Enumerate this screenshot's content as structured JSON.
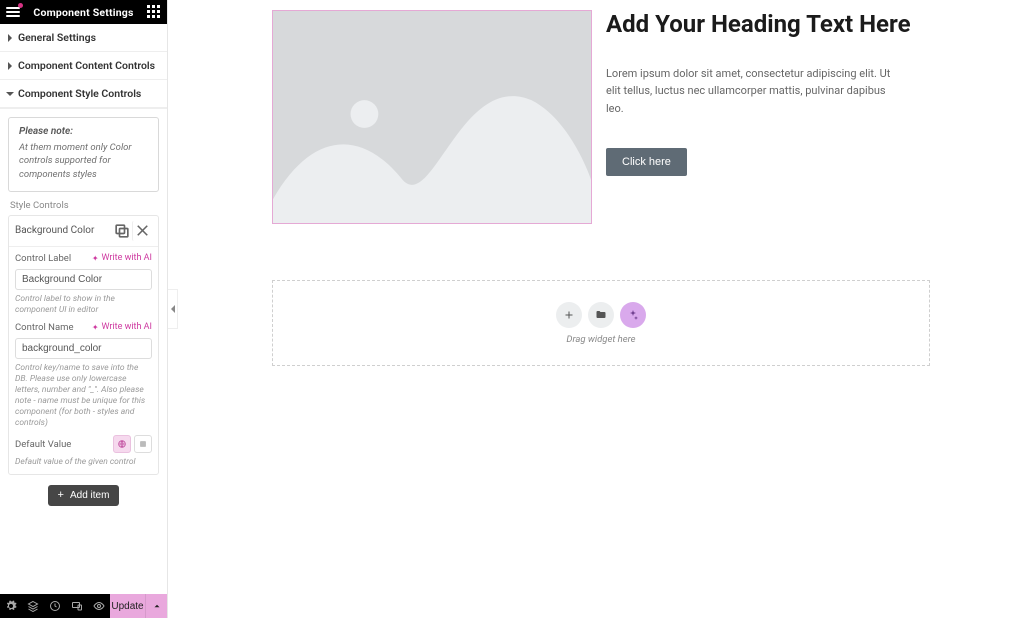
{
  "header": {
    "title": "Component Settings"
  },
  "accordion": {
    "general": "General Settings",
    "content": "Component Content Controls",
    "style": "Component Style Controls"
  },
  "note": {
    "title": "Please note:",
    "text": "At them moment only Color controls supported for components styles"
  },
  "style_controls": {
    "section_label": "Style Controls",
    "item_title": "Background Color",
    "control_label": {
      "label": "Control Label",
      "ai": "Write with AI",
      "value": "Background Color",
      "help": "Control label to show in the component UI in editor"
    },
    "control_name": {
      "label": "Control Name",
      "ai": "Write with AI",
      "value": "background_color",
      "help": "Control key/name to save into the DB. Please use only lowercase letters, number and \"_\". Also please note - name must be unique for this component (for both - styles and controls)"
    },
    "default_value": {
      "label": "Default Value",
      "help": "Default value of the given control"
    },
    "add_item": "Add item"
  },
  "footer": {
    "update": "Update"
  },
  "canvas": {
    "heading": "Add Your Heading Text Here",
    "paragraph": "Lorem ipsum dolor sit amet, consectetur adipiscing elit. Ut elit tellus, luctus nec ullamcorper mattis, pulvinar dapibus leo.",
    "button": "Click here",
    "drop_hint": "Drag widget here"
  }
}
